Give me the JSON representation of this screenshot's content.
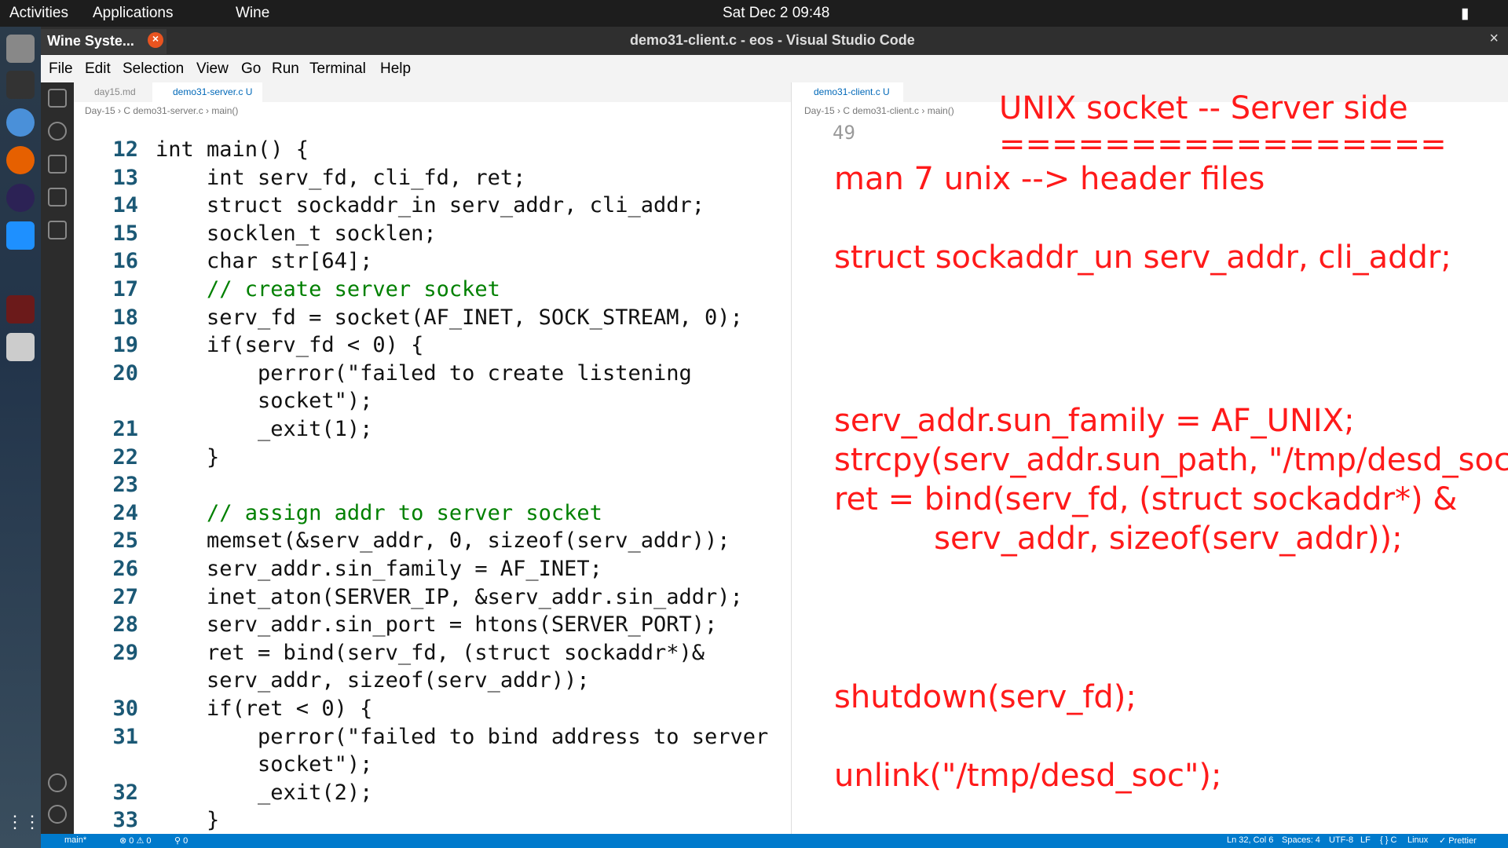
{
  "topbar": {
    "activities": "Activities",
    "applications": "Applications",
    "wine": "Wine",
    "clock": "Sat Dec 2  09:48"
  },
  "window": {
    "title": "demo31-client.c - eos - Visual Studio Code"
  },
  "popup": {
    "label": "Wine Syste..."
  },
  "menu": [
    "File",
    "Edit",
    "Selection",
    "View",
    "Go",
    "Run",
    "Terminal",
    "Help"
  ],
  "left": {
    "tabs": [
      "day15.md",
      "demo31-server.c U"
    ],
    "breadcrumb": "Day-15 › C demo31-server.c › main()"
  },
  "right": {
    "tabs": [
      "demo31-client.c U"
    ],
    "breadcrumb": "Day-15 › C demo31-client.c › main()",
    "line": "49"
  },
  "code": [
    [
      "12",
      "int main() {"
    ],
    [
      "13",
      "    int serv_fd, cli_fd, ret;"
    ],
    [
      "14",
      "    struct sockaddr_in serv_addr, cli_addr;"
    ],
    [
      "15",
      "    socklen_t socklen;"
    ],
    [
      "16",
      "    char str[64];"
    ],
    [
      "17",
      "    // create server socket"
    ],
    [
      "18",
      "    serv_fd = socket(AF_INET, SOCK_STREAM, 0);"
    ],
    [
      "19",
      "    if(serv_fd < 0) {"
    ],
    [
      "20",
      "        perror(\"failed to create listening"
    ],
    [
      "",
      "        socket\");"
    ],
    [
      "21",
      "        _exit(1);"
    ],
    [
      "22",
      "    }"
    ],
    [
      "23",
      ""
    ],
    [
      "24",
      "    // assign addr to server socket"
    ],
    [
      "25",
      "    memset(&serv_addr, 0, sizeof(serv_addr));"
    ],
    [
      "26",
      "    serv_addr.sin_family = AF_INET;"
    ],
    [
      "27",
      "    inet_aton(SERVER_IP, &serv_addr.sin_addr);"
    ],
    [
      "28",
      "    serv_addr.sin_port = htons(SERVER_PORT);"
    ],
    [
      "29",
      "    ret = bind(serv_fd, (struct sockaddr*)&"
    ],
    [
      "",
      "    serv_addr, sizeof(serv_addr));"
    ],
    [
      "30",
      "    if(ret < 0) {"
    ],
    [
      "31",
      "        perror(\"failed to bind address to server"
    ],
    [
      "",
      "        socket\");"
    ],
    [
      "32",
      "        _exit(2);"
    ],
    [
      "33",
      "    }"
    ]
  ],
  "notes": [
    "UNIX socket -- Server side",
    "=================",
    "man 7 unix --> header files",
    "struct sockaddr_un serv_addr, cli_addr;",
    "serv_addr.sun_family = AF_UNIX;",
    "strcpy(serv_addr.sun_path, \"/tmp/desd_soc\");",
    "ret = bind(serv_fd, (struct sockaddr*) &",
    "          serv_addr, sizeof(serv_addr));",
    "shutdown(serv_fd);",
    "unlink(\"/tmp/desd_soc\");"
  ],
  "status": {
    "branch": "main*",
    "problems": "⊗ 0 ⚠ 0",
    "ports": "⚲ 0",
    "pos": "Ln 32, Col 6",
    "spaces": "Spaces: 4",
    "enc": "UTF-8",
    "eol": "LF",
    "lang": "{ } C",
    "os": "Linux",
    "prettier": "✓ Prettier"
  }
}
